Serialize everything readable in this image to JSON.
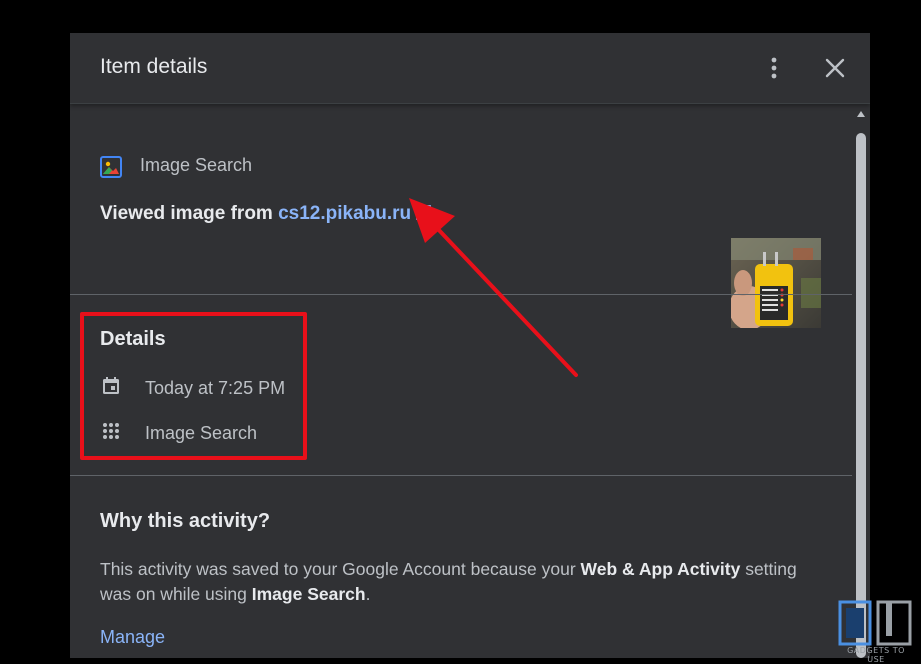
{
  "dialog": {
    "title": "Item details",
    "more_icon": "more-vert-icon",
    "close_icon": "close-icon"
  },
  "item": {
    "source_icon": "image-search-icon",
    "source_label": "Image Search",
    "viewed_prefix": "Viewed image from ",
    "link_text": "cs12.pikabu.ru",
    "link_icon": "open-in-new-icon",
    "thumbnail": "phone-charger-tester-thumbnail"
  },
  "details": {
    "title": "Details",
    "time_icon": "calendar-icon",
    "time_text": "Today at 7:25 PM",
    "product_icon": "apps-grid-icon",
    "product_text": "Image Search"
  },
  "why": {
    "title": "Why this activity?",
    "text_part1": "This activity was saved to your Google Account because your ",
    "setting_name": "Web & App Activity",
    "text_part2": " setting was on while using ",
    "product_name": "Image Search",
    "text_part3": ".",
    "manage_label": "Manage"
  },
  "annotations": {
    "box_color": "#e8101a",
    "arrow_color": "#e8101a"
  },
  "watermark": {
    "logo": "gadgets-to-use-logo",
    "text": "GADGETS TO USE"
  },
  "colors": {
    "surface": "#303134",
    "text_primary": "#e8eaed",
    "text_secondary": "#bdc1c6",
    "link": "#8ab4f8",
    "divider": "#5f6368"
  }
}
